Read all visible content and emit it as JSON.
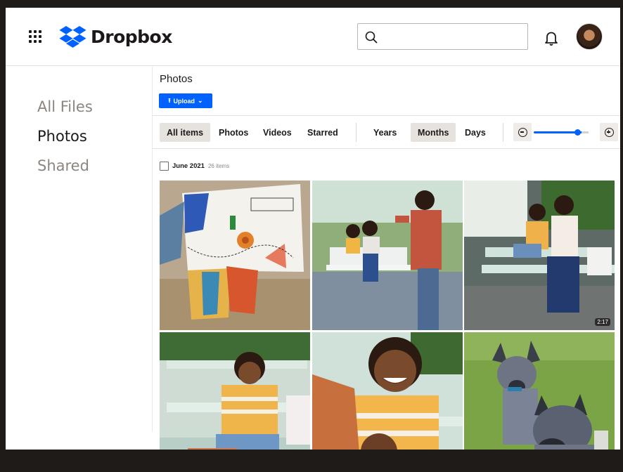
{
  "app": {
    "name": "Dropbox",
    "brand_color": "#0061FE"
  },
  "header": {
    "search_placeholder": "",
    "icons": [
      "apps-grid-icon",
      "dropbox-logo-icon",
      "search-icon",
      "bell-icon",
      "avatar"
    ]
  },
  "sidebar": {
    "items": [
      {
        "label": "All Files",
        "active": false
      },
      {
        "label": "Photos",
        "active": true
      },
      {
        "label": "Shared",
        "active": false
      }
    ]
  },
  "main": {
    "title": "Photos",
    "upload_label": "Upload",
    "upload_icon": "upload-arrow-icon",
    "filters": [
      "All items",
      "Photos",
      "Videos",
      "Starred"
    ],
    "selected_filter": "All items",
    "time_scales": [
      "Years",
      "Months",
      "Days"
    ],
    "selected_scale": "Months",
    "zoom_level": 0.85,
    "group": {
      "title": "June 2021",
      "count": "26 items"
    },
    "photos": [
      {
        "name": "art-collage-photo",
        "duration": null
      },
      {
        "name": "family-porch-swing-photo",
        "duration": null
      },
      {
        "name": "mother-son-swing-video",
        "duration": "2:17"
      },
      {
        "name": "boy-on-bench-photo",
        "duration": null
      },
      {
        "name": "boy-smiling-closeup-photo",
        "duration": null
      },
      {
        "name": "cattle-dogs-photo",
        "duration": null
      }
    ]
  }
}
